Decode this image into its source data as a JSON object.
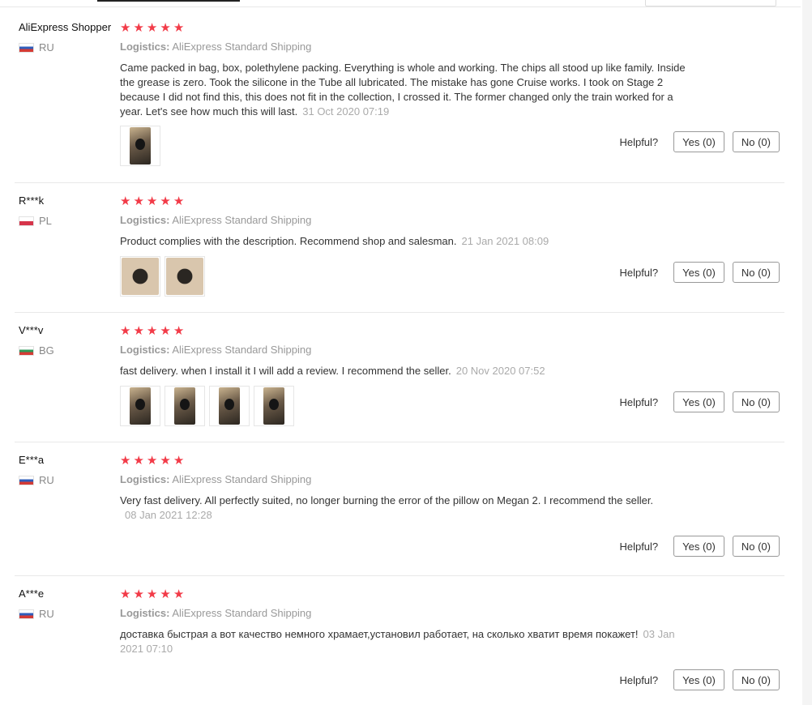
{
  "helpful_label": "Helpful?",
  "logistics_label": "Logistics:",
  "reviews": [
    {
      "user": "AliExpress Shopper",
      "country": "RU",
      "rating": 5,
      "logistics": "AliExpress Standard Shipping",
      "text": "Came packed in bag, box, polethylene packing. Everything is whole and working. The chips all stood up like family. Inside the grease is zero. Took the silicone in the Tube all lubricated. The mistake has gone Cruise works. I took on Stage 2 because I did not find this, this does not fit in the collection, I crossed it. The former changed only the train worked for a year. Let's see how much this will last.",
      "date": "31 Oct 2020 07:19",
      "photo_count": 1,
      "yes_label": "Yes (0)",
      "no_label": "No (0)"
    },
    {
      "user": "R***k",
      "country": "PL",
      "rating": 5,
      "logistics": "AliExpress Standard Shipping",
      "text": "Product complies with the description. Recommend shop and salesman.",
      "date": "21 Jan 2021 08:09",
      "photo_count": 2,
      "yes_label": "Yes (0)",
      "no_label": "No (0)"
    },
    {
      "user": "V***v",
      "country": "BG",
      "rating": 5,
      "logistics": "AliExpress Standard Shipping",
      "text": "fast delivery. when I install it I will add a review. I recommend the seller.",
      "date": "20 Nov 2020 07:52",
      "photo_count": 4,
      "yes_label": "Yes (0)",
      "no_label": "No (0)"
    },
    {
      "user": "E***a",
      "country": "RU",
      "rating": 5,
      "logistics": "AliExpress Standard Shipping",
      "text": "Very fast delivery. All perfectly suited, no longer burning the error of the pillow on Megan 2. I recommend the seller.",
      "date": "08 Jan 2021 12:28",
      "photo_count": 0,
      "yes_label": "Yes (0)",
      "no_label": "No (0)"
    },
    {
      "user": "A***e",
      "country": "RU",
      "rating": 5,
      "logistics": "AliExpress Standard Shipping",
      "text": "доставка быстрая а вот качество немного храмает,установил работает, на сколько хватит время покажет!",
      "date": "03 Jan 2021 07:10",
      "photo_count": 0,
      "yes_label": "Yes (0)",
      "no_label": "No (0)"
    }
  ]
}
